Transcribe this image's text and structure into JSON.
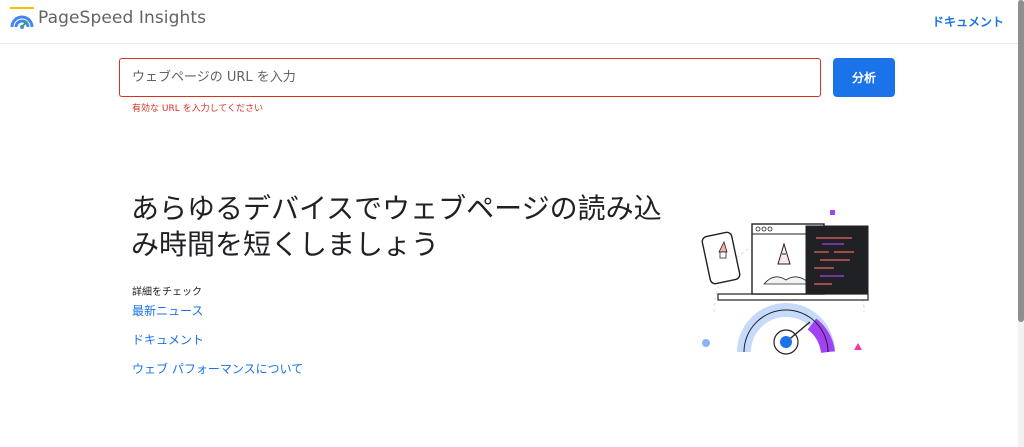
{
  "header": {
    "app_title": "PageSpeed Insights",
    "docs_link": "ドキュメント"
  },
  "search": {
    "placeholder": "ウェブページの URL を入力",
    "value": "",
    "error": "有効な URL を入力してください",
    "analyze_label": "分析"
  },
  "hero": {
    "heading": "あらゆるデバイスでウェブページの読み込み時間を短くしましょう",
    "learn_more": "詳細をチェック",
    "links": [
      {
        "label": "最新ニュース"
      },
      {
        "label": "ドキュメント"
      },
      {
        "label": "ウェブ パフォーマンスについて"
      }
    ]
  },
  "colors": {
    "accent": "#1a73e8",
    "error": "#d93025",
    "gauge_purple": "#a142f4",
    "gauge_blue": "#8ab4f8"
  }
}
